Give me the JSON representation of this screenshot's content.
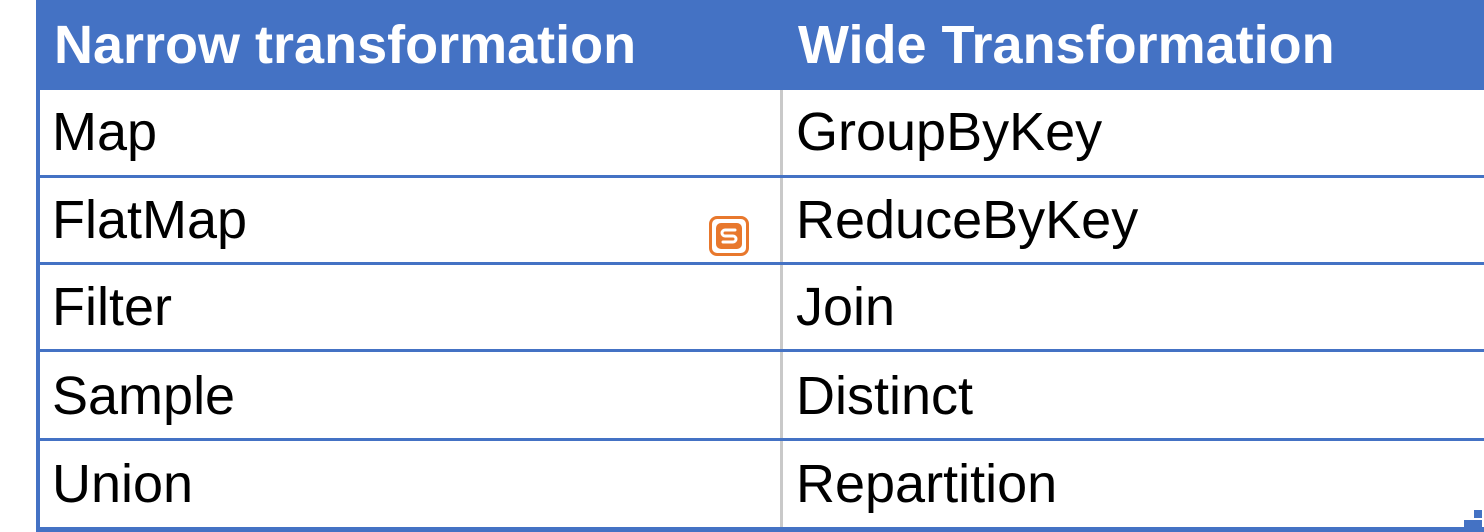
{
  "table": {
    "headers": [
      "Narrow transformation",
      "Wide Transformation"
    ],
    "rows": [
      [
        "Map",
        "GroupByKey"
      ],
      [
        "FlatMap",
        "ReduceByKey"
      ],
      [
        "Filter",
        "Join"
      ],
      [
        "Sample",
        "Distinct"
      ],
      [
        "Union",
        "Repartition"
      ]
    ]
  },
  "colors": {
    "header_bg": "#4472c4",
    "border": "#4472c4",
    "divider": "#c9c9c9",
    "badge": "#e8782d"
  },
  "icons": {
    "badge": "sogou-s-icon",
    "corner": "resize-handle-icon"
  }
}
